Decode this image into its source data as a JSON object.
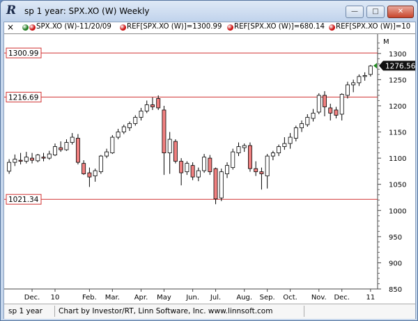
{
  "window": {
    "title": "sp 1 year: SPX.XO (W) Weekly",
    "app_icon": "R",
    "buttons": {
      "minimize": "—",
      "maximize": "□",
      "close": "✕"
    }
  },
  "legend": {
    "close_button": "×",
    "items": [
      {
        "label": "SPX.XO (W)-11/20/09",
        "dot_colors": [
          "#1f7a1f",
          "#cc1111"
        ]
      },
      {
        "label": "REF[SPX.XO (W)]=1300.99",
        "dot_colors": [
          "#cc1111"
        ]
      },
      {
        "label": "REF[SPX.XO (W)]=680.14",
        "dot_colors": [
          "#cc1111"
        ]
      },
      {
        "label": "REF[SPX.XO (W)]=10",
        "dot_colors": [
          "#cc1111"
        ]
      }
    ],
    "m_label": "M"
  },
  "chart_data": {
    "type": "candlestick",
    "symbol": "SPX.XO",
    "period": "Weekly",
    "ylim": [
      850,
      1300
    ],
    "yticks": [
      850,
      900,
      950,
      1000,
      1050,
      1100,
      1150,
      1200,
      1250,
      1300
    ],
    "xticks": [
      {
        "label": "Dec.",
        "index": 4
      },
      {
        "label": "10",
        "index": 8
      },
      {
        "label": "Feb.",
        "index": 14
      },
      {
        "label": "Mar.",
        "index": 18
      },
      {
        "label": "Apr.",
        "index": 23
      },
      {
        "label": "May",
        "index": 27
      },
      {
        "label": "Jun.",
        "index": 32
      },
      {
        "label": "Jul.",
        "index": 36
      },
      {
        "label": "Aug.",
        "index": 41
      },
      {
        "label": "Sep.",
        "index": 45
      },
      {
        "label": "Oct.",
        "index": 49
      },
      {
        "label": "Nov.",
        "index": 54
      },
      {
        "label": "Dec.",
        "index": 58
      },
      {
        "label": "11",
        "index": 63
      }
    ],
    "reference_lines": [
      {
        "label": "1300.99",
        "value": 1300.99,
        "color": "#d03030"
      },
      {
        "label": "1216.69",
        "value": 1216.69,
        "color": "#d03030"
      },
      {
        "label": "1021.34",
        "value": 1021.34,
        "color": "#d03030"
      }
    ],
    "last_price": {
      "label": "1276.56",
      "value": 1276.56
    },
    "up_color": "#ffffff",
    "down_color": "#f08080",
    "candles": [
      {
        "o": 1075,
        "h": 1098,
        "l": 1070,
        "c": 1092
      },
      {
        "o": 1092,
        "h": 1107,
        "l": 1085,
        "c": 1098
      },
      {
        "o": 1096,
        "h": 1110,
        "l": 1088,
        "c": 1094
      },
      {
        "o": 1094,
        "h": 1112,
        "l": 1090,
        "c": 1102
      },
      {
        "o": 1100,
        "h": 1110,
        "l": 1090,
        "c": 1096
      },
      {
        "o": 1095,
        "h": 1108,
        "l": 1092,
        "c": 1106
      },
      {
        "o": 1102,
        "h": 1110,
        "l": 1094,
        "c": 1100
      },
      {
        "o": 1100,
        "h": 1114,
        "l": 1097,
        "c": 1108
      },
      {
        "o": 1106,
        "h": 1128,
        "l": 1104,
        "c": 1122
      },
      {
        "o": 1120,
        "h": 1132,
        "l": 1112,
        "c": 1116
      },
      {
        "o": 1116,
        "h": 1136,
        "l": 1114,
        "c": 1130
      },
      {
        "o": 1130,
        "h": 1148,
        "l": 1126,
        "c": 1140
      },
      {
        "o": 1138,
        "h": 1146,
        "l": 1088,
        "c": 1092
      },
      {
        "o": 1090,
        "h": 1096,
        "l": 1068,
        "c": 1070
      },
      {
        "o": 1072,
        "h": 1082,
        "l": 1045,
        "c": 1064
      },
      {
        "o": 1066,
        "h": 1080,
        "l": 1055,
        "c": 1076
      },
      {
        "o": 1074,
        "h": 1106,
        "l": 1070,
        "c": 1104
      },
      {
        "o": 1104,
        "h": 1118,
        "l": 1100,
        "c": 1112
      },
      {
        "o": 1110,
        "h": 1144,
        "l": 1108,
        "c": 1140
      },
      {
        "o": 1140,
        "h": 1156,
        "l": 1136,
        "c": 1150
      },
      {
        "o": 1150,
        "h": 1164,
        "l": 1146,
        "c": 1160
      },
      {
        "o": 1158,
        "h": 1170,
        "l": 1152,
        "c": 1166
      },
      {
        "o": 1166,
        "h": 1182,
        "l": 1162,
        "c": 1178
      },
      {
        "o": 1178,
        "h": 1196,
        "l": 1172,
        "c": 1190
      },
      {
        "o": 1190,
        "h": 1210,
        "l": 1186,
        "c": 1202
      },
      {
        "o": 1202,
        "h": 1216,
        "l": 1192,
        "c": 1198
      },
      {
        "o": 1214,
        "h": 1220,
        "l": 1192,
        "c": 1196
      },
      {
        "o": 1192,
        "h": 1200,
        "l": 1068,
        "c": 1110
      },
      {
        "o": 1110,
        "h": 1150,
        "l": 1070,
        "c": 1136
      },
      {
        "o": 1132,
        "h": 1136,
        "l": 1090,
        "c": 1094
      },
      {
        "o": 1094,
        "h": 1100,
        "l": 1048,
        "c": 1072
      },
      {
        "o": 1074,
        "h": 1094,
        "l": 1068,
        "c": 1090
      },
      {
        "o": 1086,
        "h": 1092,
        "l": 1058,
        "c": 1064
      },
      {
        "o": 1064,
        "h": 1082,
        "l": 1056,
        "c": 1076
      },
      {
        "o": 1076,
        "h": 1108,
        "l": 1072,
        "c": 1102
      },
      {
        "o": 1100,
        "h": 1106,
        "l": 1068,
        "c": 1074
      },
      {
        "o": 1080,
        "h": 1082,
        "l": 1012,
        "c": 1022
      },
      {
        "o": 1024,
        "h": 1080,
        "l": 1018,
        "c": 1074
      },
      {
        "o": 1070,
        "h": 1092,
        "l": 1062,
        "c": 1086
      },
      {
        "o": 1082,
        "h": 1118,
        "l": 1078,
        "c": 1112
      },
      {
        "o": 1110,
        "h": 1130,
        "l": 1104,
        "c": 1122
      },
      {
        "o": 1120,
        "h": 1128,
        "l": 1112,
        "c": 1124
      },
      {
        "o": 1124,
        "h": 1130,
        "l": 1074,
        "c": 1080
      },
      {
        "o": 1080,
        "h": 1094,
        "l": 1066,
        "c": 1074
      },
      {
        "o": 1074,
        "h": 1082,
        "l": 1040,
        "c": 1070
      },
      {
        "o": 1066,
        "h": 1108,
        "l": 1042,
        "c": 1104
      },
      {
        "o": 1104,
        "h": 1114,
        "l": 1096,
        "c": 1110
      },
      {
        "o": 1110,
        "h": 1126,
        "l": 1104,
        "c": 1122
      },
      {
        "o": 1122,
        "h": 1140,
        "l": 1116,
        "c": 1128
      },
      {
        "o": 1128,
        "h": 1148,
        "l": 1118,
        "c": 1140
      },
      {
        "o": 1138,
        "h": 1162,
        "l": 1132,
        "c": 1158
      },
      {
        "o": 1158,
        "h": 1172,
        "l": 1150,
        "c": 1166
      },
      {
        "o": 1164,
        "h": 1184,
        "l": 1160,
        "c": 1178
      },
      {
        "o": 1176,
        "h": 1194,
        "l": 1170,
        "c": 1186
      },
      {
        "o": 1188,
        "h": 1224,
        "l": 1184,
        "c": 1220
      },
      {
        "o": 1220,
        "h": 1228,
        "l": 1180,
        "c": 1198
      },
      {
        "o": 1196,
        "h": 1204,
        "l": 1172,
        "c": 1186
      },
      {
        "o": 1192,
        "h": 1198,
        "l": 1176,
        "c": 1182
      },
      {
        "o": 1184,
        "h": 1224,
        "l": 1172,
        "c": 1222
      },
      {
        "o": 1220,
        "h": 1246,
        "l": 1214,
        "c": 1240
      },
      {
        "o": 1240,
        "h": 1250,
        "l": 1226,
        "c": 1244
      },
      {
        "o": 1244,
        "h": 1260,
        "l": 1238,
        "c": 1256
      },
      {
        "o": 1256,
        "h": 1264,
        "l": 1248,
        "c": 1258
      },
      {
        "o": 1260,
        "h": 1278,
        "l": 1256,
        "c": 1276
      }
    ]
  },
  "status_bar": {
    "left": "sp 1 year",
    "center": "Chart by Investor/RT, Linn Software, Inc. www.linnsoft.com"
  }
}
